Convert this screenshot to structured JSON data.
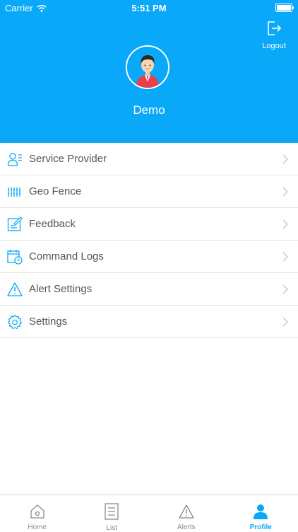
{
  "status_bar": {
    "carrier": "Carrier",
    "time": "5:51 PM"
  },
  "header": {
    "logout_label": "Logout",
    "user_name": "Demo"
  },
  "menu": {
    "items": [
      {
        "label": "Service Provider",
        "icon": "user-lines-icon"
      },
      {
        "label": "Geo Fence",
        "icon": "fence-icon"
      },
      {
        "label": "Feedback",
        "icon": "edit-icon"
      },
      {
        "label": "Command Logs",
        "icon": "calendar-clock-icon"
      },
      {
        "label": "Alert Settings",
        "icon": "warning-icon"
      },
      {
        "label": "Settings",
        "icon": "gear-icon"
      }
    ]
  },
  "tabbar": {
    "tabs": [
      {
        "label": "Home",
        "icon": "home-icon",
        "active": false
      },
      {
        "label": "List",
        "icon": "list-icon",
        "active": false
      },
      {
        "label": "Alerts",
        "icon": "alert-icon",
        "active": false
      },
      {
        "label": "Profile",
        "icon": "profile-icon",
        "active": true
      }
    ]
  },
  "colors": {
    "accent": "#0aa8f8",
    "text": "#555555",
    "divider": "#e4e4e4",
    "tab_inactive": "#8a8a8a"
  }
}
